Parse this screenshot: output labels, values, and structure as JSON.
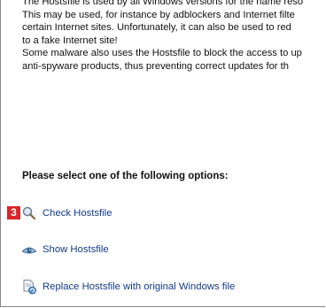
{
  "description": {
    "lines": [
      "The Hostsfile is used by all Windows versions for the name reso",
      "This may be used, for instance by adblockers and Internet filte",
      "certain Internet sites. Unfortunately, it can also be used to red",
      "to a fake Internet site!",
      "Some malware also uses the Hostsfile to block the access to up",
      "anti-spyware products, thus preventing correct updates for th"
    ]
  },
  "options_heading": "Please select one of the following options:",
  "options": [
    {
      "label": "Check Hostsfile",
      "icon": "magnifier-icon"
    },
    {
      "label": "Show Hostsfile",
      "icon": "view-eye-icon"
    },
    {
      "label": "Replace Hostsfile with original Windows file",
      "icon": "replace-file-icon"
    }
  ],
  "annotation_badge": "3",
  "colors": {
    "link": "#123a8c",
    "badge": "#d8262b"
  }
}
